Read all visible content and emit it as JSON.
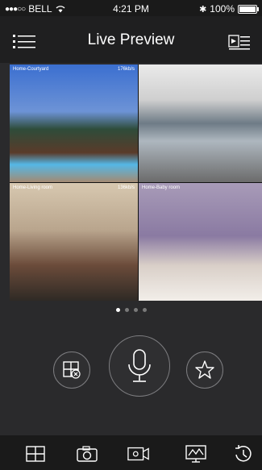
{
  "status_bar": {
    "carrier": "BELL",
    "signal_dots": "●●●○○",
    "time": "4:21 PM",
    "battery": "100%"
  },
  "nav": {
    "title": "Live Preview"
  },
  "cameras": [
    {
      "label": "Home-Courtyard",
      "rate": "176kb/s"
    },
    {
      "label": "",
      "rate": ""
    },
    {
      "label": "Home-Living room",
      "rate": "136kb/s"
    },
    {
      "label": "Home-Baby room",
      "rate": ""
    }
  ],
  "pager": {
    "pages": 4,
    "active": 0
  },
  "controls": {
    "left": "close-window-icon",
    "center": "microphone-icon",
    "right": "star-icon"
  },
  "bottom_bar": [
    "grid-icon",
    "camera-icon",
    "record-icon",
    "activity-icon",
    "playback-icon"
  ],
  "colors": {
    "background": "#2a2a2c",
    "bar": "#1a1a1a",
    "accent": "#ffffff"
  }
}
